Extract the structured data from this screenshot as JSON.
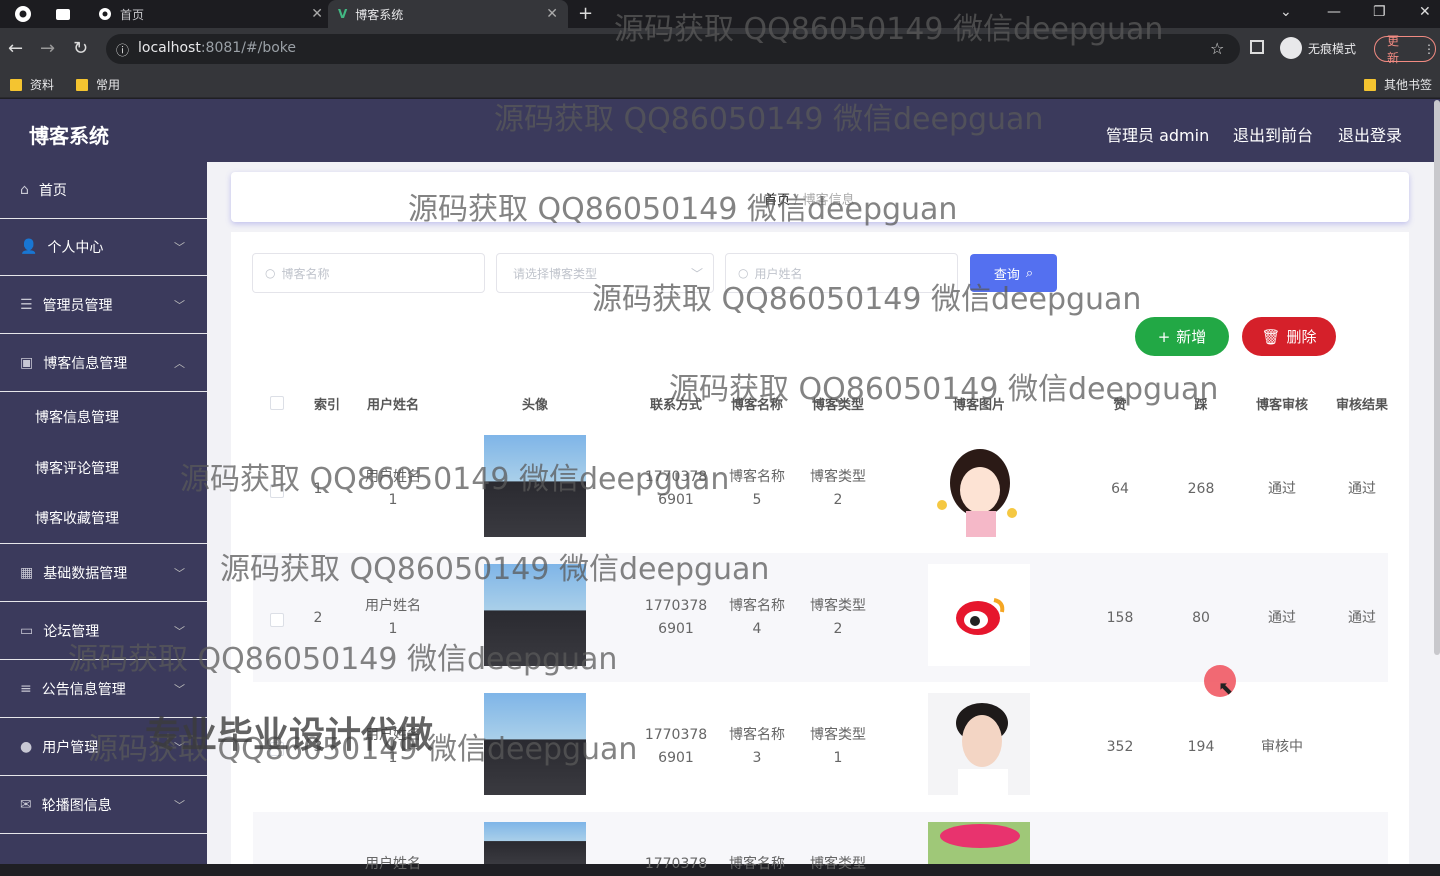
{
  "browser": {
    "tabs": [
      {
        "label": "首页"
      },
      {
        "label": "博客系统"
      }
    ],
    "url_host": "localhost",
    "url_rest": ":8081/#/boke",
    "incognito_label": "无痕模式",
    "update_label": "更新",
    "bookmarks": [
      {
        "label": "资料"
      },
      {
        "label": "常用"
      },
      {
        "label": "其他书签"
      }
    ]
  },
  "header": {
    "title": "博客系统",
    "admin_label": "管理员 admin",
    "frontend_label": "退出到前台",
    "logout_label": "退出登录"
  },
  "sidebar": {
    "items": [
      {
        "label": "首页"
      },
      {
        "label": "个人中心"
      },
      {
        "label": "管理员管理"
      },
      {
        "label": "博客信息管理"
      },
      {
        "label": "基础数据管理"
      },
      {
        "label": "论坛管理"
      },
      {
        "label": "公告信息管理"
      },
      {
        "label": "用户管理"
      },
      {
        "label": "轮播图信息"
      }
    ],
    "subitems": [
      {
        "label": "博客信息管理"
      },
      {
        "label": "博客评论管理"
      },
      {
        "label": "博客收藏管理"
      }
    ]
  },
  "breadcrumb": {
    "home": "首页",
    "current": "博客信息"
  },
  "search": {
    "name_placeholder": "博客名称",
    "type_placeholder": "请选择博客类型",
    "user_placeholder": "用户姓名",
    "query_label": "查询"
  },
  "actions": {
    "add_label": "新增",
    "delete_label": "删除"
  },
  "table": {
    "headers": [
      "索引",
      "用户姓名",
      "头像",
      "联系方式",
      "博客名称",
      "博客类型",
      "博客图片",
      "赞",
      "踩",
      "博客审核",
      "审核结果"
    ],
    "rows": [
      {
        "index": "1",
        "user": "用户姓名\n1",
        "phone": "1770378\n6901",
        "blog_name": "博客名称\n5",
        "blog_type": "博客类型\n2",
        "likes": "64",
        "dislikes": "268",
        "review": "通过",
        "result": "通过"
      },
      {
        "index": "2",
        "user": "用户姓名\n1",
        "phone": "1770378\n6901",
        "blog_name": "博客名称\n4",
        "blog_type": "博客类型\n2",
        "likes": "158",
        "dislikes": "80",
        "review": "通过",
        "result": "通过"
      },
      {
        "index": "3",
        "user": "用户姓名\n1",
        "phone": "1770378\n6901",
        "blog_name": "博客名称\n3",
        "blog_type": "博客类型\n1",
        "likes": "352",
        "dislikes": "194",
        "review": "审核中",
        "result": ""
      },
      {
        "index": "",
        "user": "用户姓名",
        "phone": "1770378",
        "blog_name": "博客名称",
        "blog_type": "博客类型",
        "likes": "",
        "dislikes": "",
        "review": "",
        "result": ""
      }
    ]
  },
  "watermarks": {
    "text": "源码获取 QQ86050149 微信deepguan",
    "promo": "专业毕业设计代做"
  }
}
